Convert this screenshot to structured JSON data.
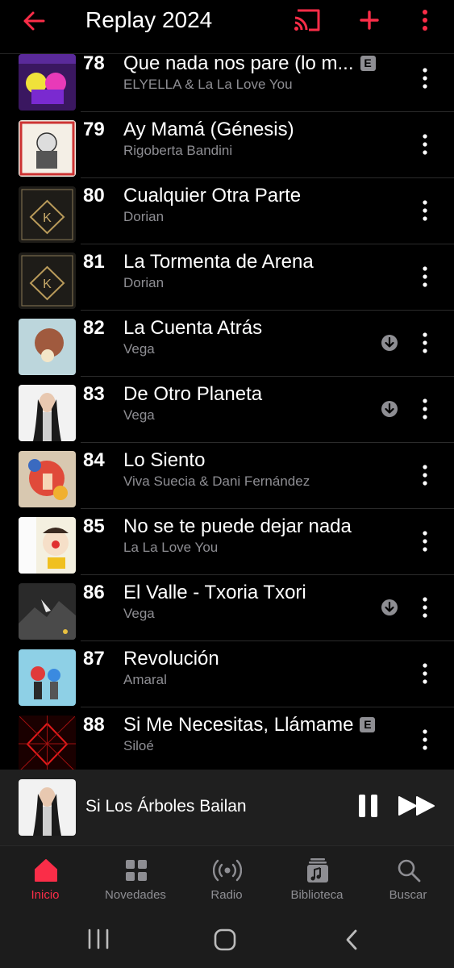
{
  "header": {
    "title": "Replay 2024",
    "icons": [
      "back-arrow-icon",
      "cast-icon",
      "add-icon",
      "more-vertical-icon"
    ],
    "accent_color": "#fa2d48"
  },
  "songs": [
    {
      "rank": "78",
      "title": "Que nada nos pare (lo m...",
      "artist": "ELYELLA & La La Love You",
      "explicit": true,
      "downloaded": false
    },
    {
      "rank": "79",
      "title": "Ay Mamá (Génesis)",
      "artist": "Rigoberta Bandini",
      "explicit": false,
      "downloaded": false
    },
    {
      "rank": "80",
      "title": "Cualquier Otra Parte",
      "artist": "Dorian",
      "explicit": false,
      "downloaded": false
    },
    {
      "rank": "81",
      "title": "La Tormenta de Arena",
      "artist": "Dorian",
      "explicit": false,
      "downloaded": false
    },
    {
      "rank": "82",
      "title": "La Cuenta Atrás",
      "artist": "Vega",
      "explicit": false,
      "downloaded": true
    },
    {
      "rank": "83",
      "title": "De Otro Planeta",
      "artist": "Vega",
      "explicit": false,
      "downloaded": true
    },
    {
      "rank": "84",
      "title": "Lo Siento",
      "artist": "Viva Suecia & Dani Fernández",
      "explicit": false,
      "downloaded": false
    },
    {
      "rank": "85",
      "title": "No se te puede dejar nada",
      "artist": "La La Love You",
      "explicit": false,
      "downloaded": false
    },
    {
      "rank": "86",
      "title": "El Valle - Txoria Txori",
      "artist": "Vega",
      "explicit": false,
      "downloaded": true
    },
    {
      "rank": "87",
      "title": "Revolución",
      "artist": "Amaral",
      "explicit": false,
      "downloaded": false
    },
    {
      "rank": "88",
      "title": "Si Me Necesitas, Llámame",
      "artist": "Siloé",
      "explicit": true,
      "downloaded": false
    }
  ],
  "explicit_badge": "E",
  "now_playing": {
    "title": "Si Los Árboles Bailan",
    "icons": [
      "pause-icon",
      "next-track-icon"
    ]
  },
  "tabs": [
    {
      "label": "Inicio",
      "icon": "home-icon",
      "active": true
    },
    {
      "label": "Novedades",
      "icon": "grid-icon",
      "active": false
    },
    {
      "label": "Radio",
      "icon": "radio-icon",
      "active": false
    },
    {
      "label": "Biblioteca",
      "icon": "library-icon",
      "active": false
    },
    {
      "label": "Buscar",
      "icon": "search-icon",
      "active": false
    }
  ],
  "system_nav": [
    "recent-apps-icon",
    "home-button-icon",
    "back-icon"
  ]
}
